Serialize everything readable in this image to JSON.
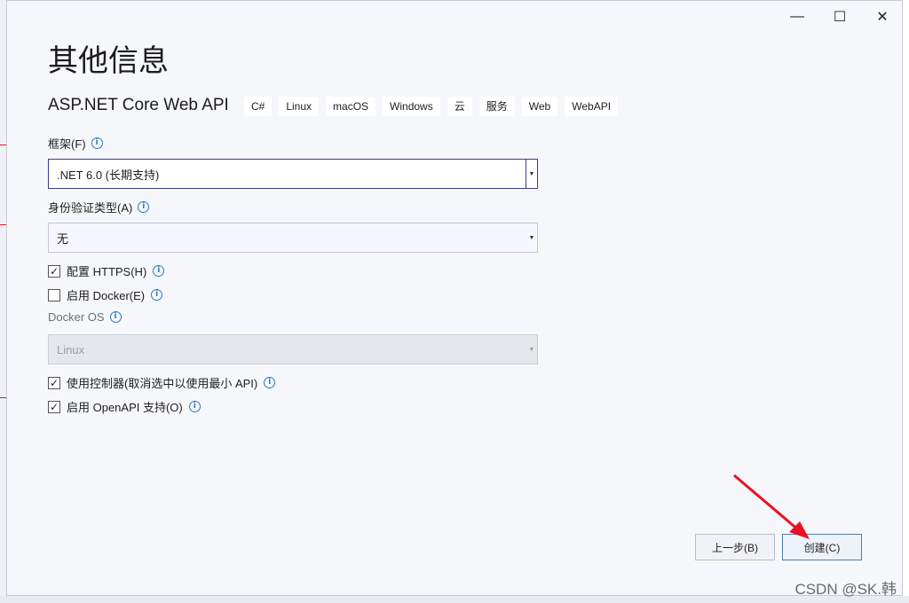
{
  "title": "其他信息",
  "subtitle": "ASP.NET Core Web API",
  "tags": [
    "C#",
    "Linux",
    "macOS",
    "Windows",
    "云",
    "服务",
    "Web",
    "WebAPI"
  ],
  "framework": {
    "label": "框架(F)",
    "value": ".NET 6.0 (长期支持)"
  },
  "auth": {
    "label": "身份验证类型(A)",
    "value": "无"
  },
  "https": {
    "label": "配置 HTTPS(H)",
    "checked": true
  },
  "docker": {
    "label": "启用 Docker(E)",
    "checked": false
  },
  "docker_os": {
    "label": "Docker OS",
    "value": "Linux"
  },
  "controllers": {
    "label": "使用控制器(取消选中以使用最小 API)",
    "checked": true
  },
  "openapi": {
    "label": "启用 OpenAPI 支持(O)",
    "checked": true
  },
  "buttons": {
    "back": "上一步(B)",
    "create": "创建(C)"
  },
  "window_controls": {
    "minimize": "—",
    "maximize": "☐",
    "close": "✕"
  },
  "check_glyph": "✓",
  "info_glyph": "i",
  "watermark": "CSDN @SK.韩",
  "colors": {
    "accent": "#3d3d8f",
    "info": "#2a78c2",
    "annotation": "#e81123"
  }
}
